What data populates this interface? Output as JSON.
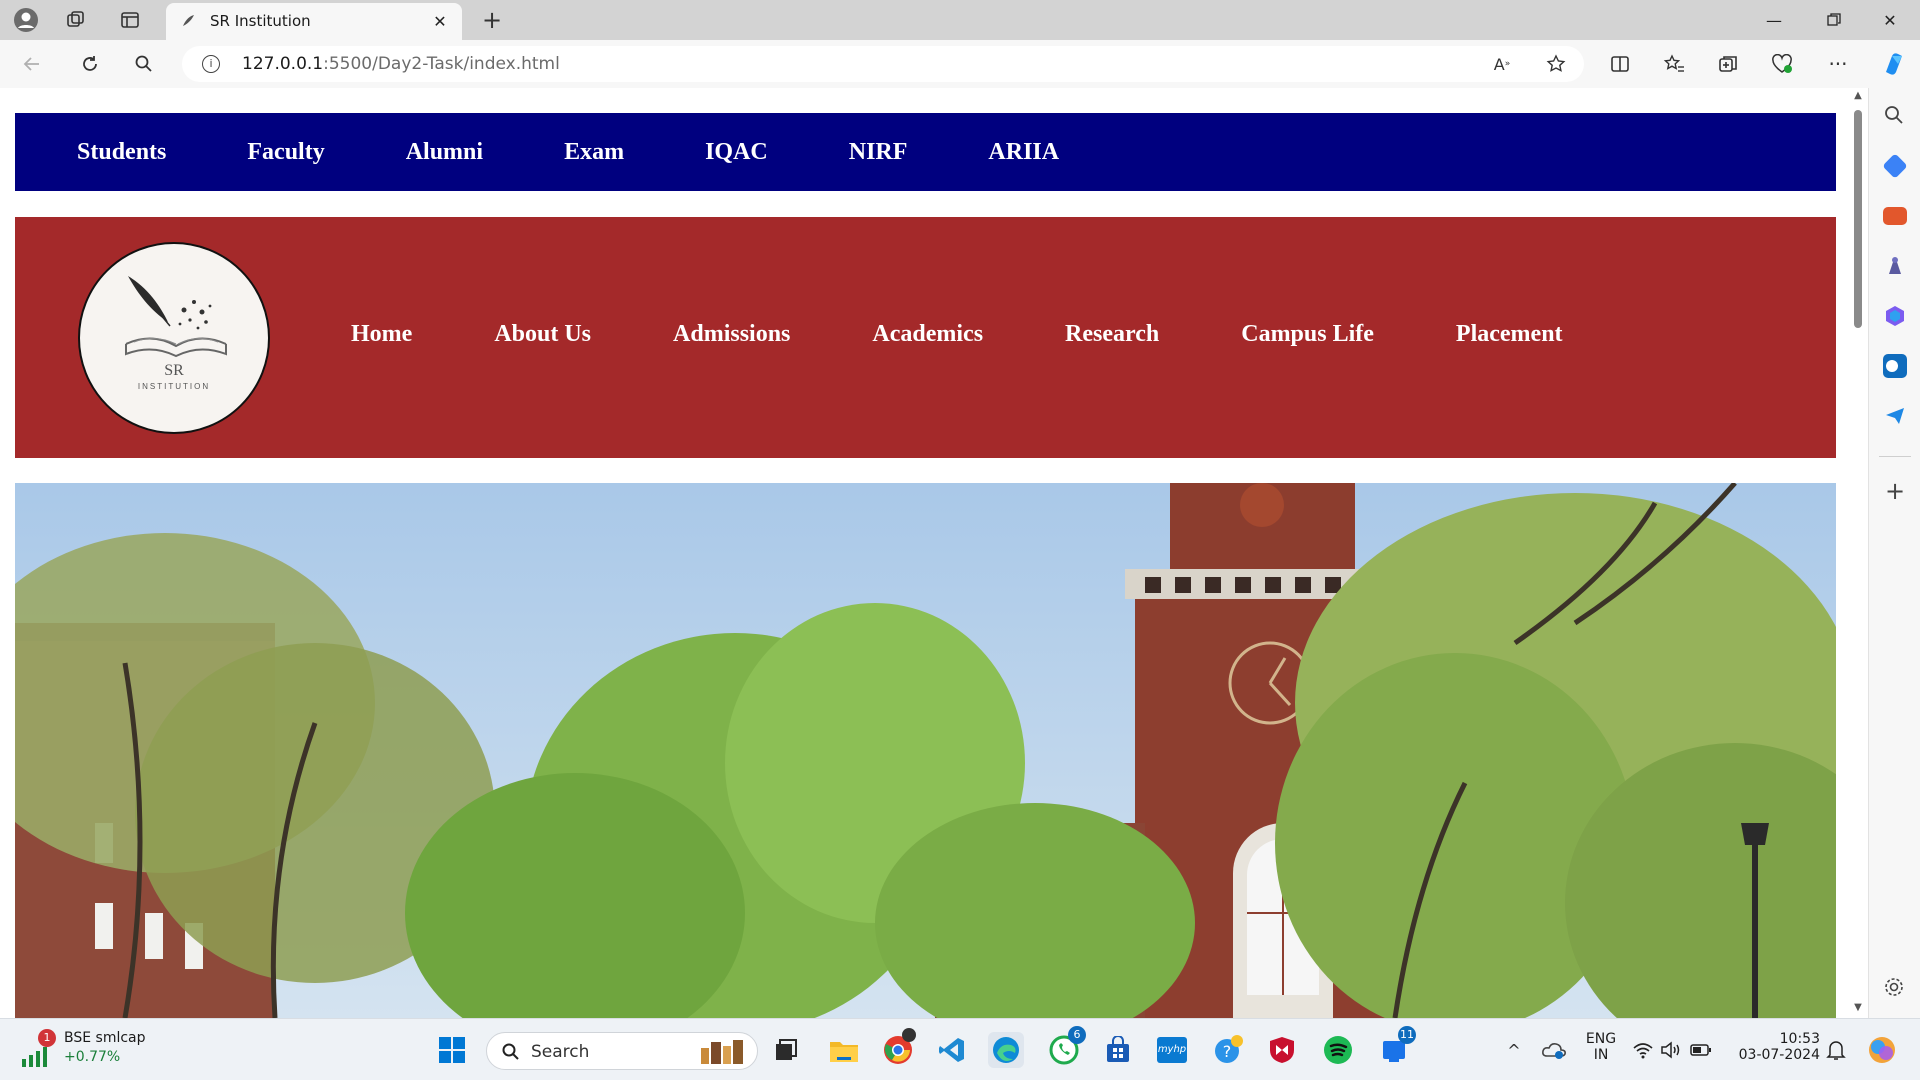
{
  "browser": {
    "tab_title": "SR Institution",
    "url_host": "127.0.0.1",
    "url_rest": ":5500/Day2-Task/index.html"
  },
  "site": {
    "top_nav": [
      "Students",
      "Faculty",
      "Alumni",
      "Exam",
      "IQAC",
      "NIRF",
      "ARIIA"
    ],
    "logo_mark": "SR",
    "logo_text": "INSTITUTION",
    "main_nav": [
      "Home",
      "About Us",
      "Admissions",
      "Academics",
      "Research",
      "Campus Life",
      "Placement"
    ]
  },
  "taskbar": {
    "widget_title": "BSE smlcap",
    "widget_value": "+0.77%",
    "widget_badge": "1",
    "search_placeholder": "Search",
    "whatsapp_badge": "6",
    "todo_badge": "11",
    "lang_top": "ENG",
    "lang_bottom": "IN",
    "time": "10:53",
    "date": "03-07-2024"
  },
  "colors": {
    "top_nav_bg": "#00007f",
    "main_nav_bg": "#a4292a"
  }
}
